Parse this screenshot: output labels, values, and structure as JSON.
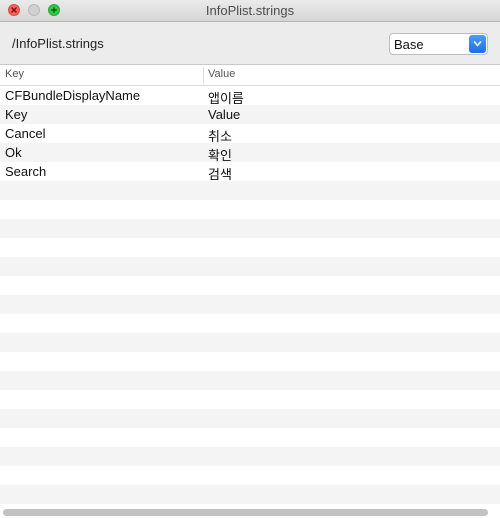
{
  "window": {
    "title": "InfoPlist.strings"
  },
  "header": {
    "path": "/InfoPlist.strings",
    "locale_selected": "Base"
  },
  "table": {
    "columns": [
      "Key",
      "Value"
    ],
    "rows": [
      {
        "key": "CFBundleDisplayName",
        "value": "앱이름"
      },
      {
        "key": "Key",
        "value": "Value"
      },
      {
        "key": "Cancel",
        "value": "취소"
      },
      {
        "key": "Ok",
        "value": "확인"
      },
      {
        "key": "Search",
        "value": "검색"
      }
    ],
    "empty_rows": 17
  },
  "icons": {
    "close": "close-icon",
    "minimize": "minimize-icon",
    "maximize": "maximize-icon",
    "dropdown": "chevron-up-down-icon"
  },
  "colors": {
    "close": "#fc605b",
    "maximize": "#34c84a",
    "accent": "#1c6fe3",
    "row_alt": "#f4f4f4"
  }
}
